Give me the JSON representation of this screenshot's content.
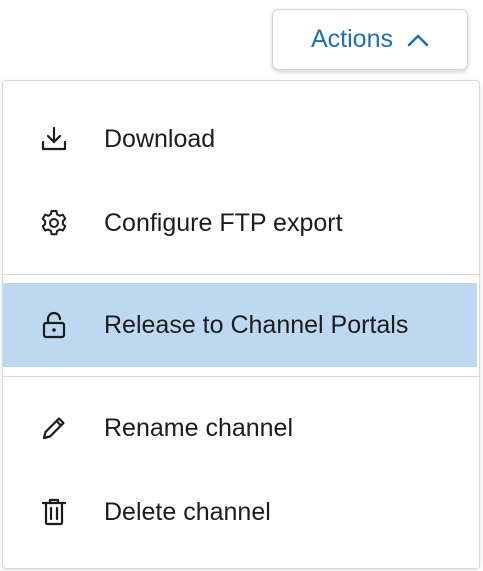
{
  "actions_button": {
    "label": "Actions",
    "icon": "chevron-up-icon",
    "accent_color": "#1f6fb8"
  },
  "menu": {
    "highlight_color": "#bdd9f2",
    "groups": [
      {
        "items": [
          {
            "label": "Download",
            "icon": "download-icon"
          },
          {
            "label": "Configure FTP export",
            "icon": "gear-icon"
          }
        ]
      },
      {
        "items": [
          {
            "label": "Release to Channel Portals",
            "icon": "unlock-icon",
            "highlighted": true
          }
        ]
      },
      {
        "items": [
          {
            "label": "Rename channel",
            "icon": "pencil-icon"
          },
          {
            "label": "Delete channel",
            "icon": "trash-icon"
          }
        ]
      }
    ]
  }
}
